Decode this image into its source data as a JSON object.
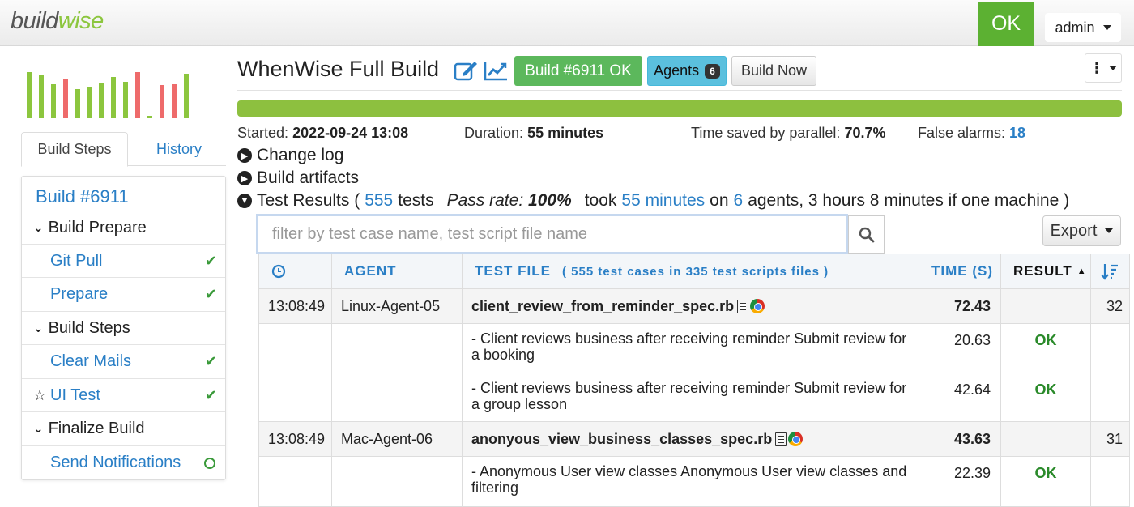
{
  "header": {
    "logo_part1": "build",
    "logo_part2": "wise",
    "status": "OK",
    "user": "admin"
  },
  "sparkline": {
    "bars": [
      {
        "value": 0.95,
        "status": "ok"
      },
      {
        "value": 0.88,
        "status": "ok"
      },
      {
        "value": 0.7,
        "status": "ok"
      },
      {
        "value": 0.8,
        "status": "fail"
      },
      {
        "value": 0.6,
        "status": "ok"
      },
      {
        "value": 0.65,
        "status": "ok"
      },
      {
        "value": 0.72,
        "status": "ok"
      },
      {
        "value": 0.85,
        "status": "ok"
      },
      {
        "value": 0.75,
        "status": "ok"
      },
      {
        "value": 0.95,
        "status": "fail"
      },
      {
        "value": 0.05,
        "status": "ok"
      },
      {
        "value": 0.68,
        "status": "fail"
      },
      {
        "value": 0.7,
        "status": "fail"
      },
      {
        "value": 0.92,
        "status": "ok"
      }
    ],
    "colors": {
      "ok": "#8cc63e",
      "fail": "#ee6b6b"
    }
  },
  "left_tabs": {
    "active": "Build Steps",
    "other": "History"
  },
  "steps_panel": {
    "build_link": "Build #6911",
    "groups": [
      {
        "label": "Build Prepare"
      },
      {
        "label": "Build Steps"
      },
      {
        "label": "Finalize Build"
      }
    ],
    "items": [
      {
        "label": "Git Pull",
        "status": "passed"
      },
      {
        "label": "Prepare",
        "status": "passed"
      },
      {
        "label": "Clear Mails",
        "status": "passed"
      },
      {
        "label": "UI Test",
        "status": "passed"
      },
      {
        "label": "Send Notifications",
        "status": "pending"
      }
    ]
  },
  "main": {
    "title": "WhenWise Full Build",
    "build_button": "Build #6911 OK",
    "agents_button": "Agents",
    "agents_count": "6",
    "build_now_button": "Build Now",
    "more_menu": "⋮",
    "progress_percent": 100,
    "accent": "#8dc03f"
  },
  "info": {
    "started_label": "Started:",
    "started_value": "2022-09-24 13:08",
    "duration_label": "Duration:",
    "duration_value": "55 minutes",
    "time_saved_label": "Time saved by parallel:",
    "time_saved_value": "70.7%",
    "false_alarms_label": "False alarms:",
    "false_alarms_value": "18"
  },
  "sections": {
    "change_log": "Change log",
    "build_artifacts": "Build artifacts",
    "test_results_prefix": "Test Results (",
    "test_count": "555",
    "tests_word": "tests",
    "pass_rate_label": "Pass rate:",
    "pass_rate_value": "100%",
    "took": "took",
    "took_value": "55 minutes",
    "on": "on",
    "agents_value": "6",
    "suffix": "agents, 3 hours 8 minutes if one machine )"
  },
  "filter": {
    "placeholder": "filter by test case name, test script file name",
    "export_label": "Export"
  },
  "table": {
    "headers": {
      "agent": "AGENT",
      "test_file": "TEST FILE",
      "test_file_summary": "( 555 test cases in 335 test scripts files )",
      "time": "TIME (S)",
      "result": "RESULT"
    },
    "rows": [
      {
        "type": "file",
        "time": "13:08:49",
        "agent": "Linux-Agent-05",
        "file": "client_review_from_reminder_spec.rb",
        "secs": "72.43",
        "count": "32"
      },
      {
        "type": "case",
        "desc": "- Client reviews business after receiving reminder Submit review for a booking",
        "secs": "20.63",
        "result": "OK"
      },
      {
        "type": "case",
        "desc": "- Client reviews business after receiving reminder Submit review for a group lesson",
        "secs": "42.64",
        "result": "OK"
      },
      {
        "type": "file",
        "time": "13:08:49",
        "agent": "Mac-Agent-06",
        "file": "anonyous_view_business_classes_spec.rb",
        "secs": "43.63",
        "count": "31"
      },
      {
        "type": "case",
        "desc": "- Anonymous User view classes Anonymous User view classes and filtering",
        "secs": "22.39",
        "result": "OK"
      }
    ]
  }
}
